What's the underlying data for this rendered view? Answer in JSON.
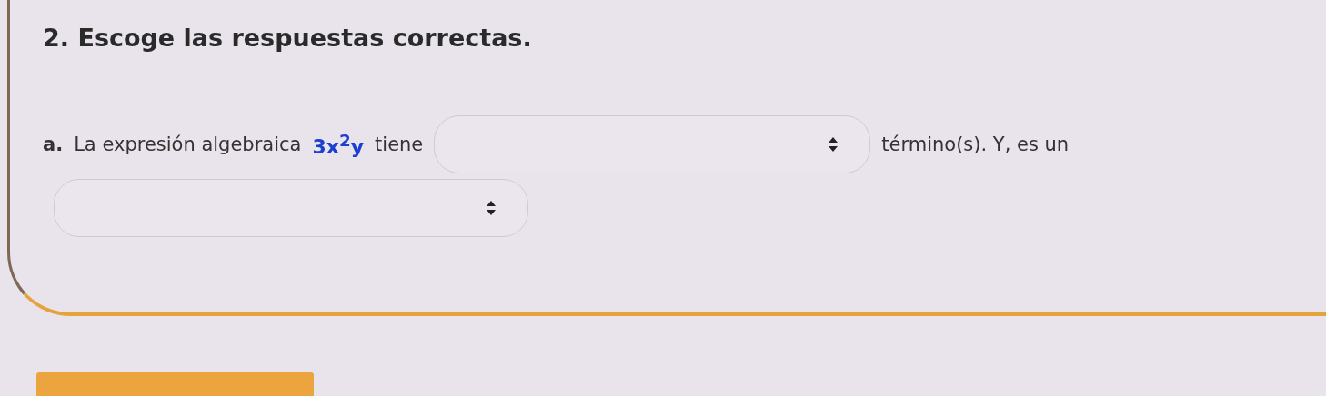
{
  "title": "2. Escoge las respuestas correctas.",
  "question": {
    "label": "a.",
    "parts": [
      {
        "kind": "text",
        "text": "La expresión algebraica"
      },
      {
        "kind": "math",
        "text": "3x$^{2}$y"
      },
      {
        "kind": "text",
        "text": "tiene"
      },
      {
        "kind": "select"
      },
      {
        "kind": "text",
        "text": "término(s). Y,  es un"
      },
      {
        "kind": "select"
      }
    ]
  }
}
